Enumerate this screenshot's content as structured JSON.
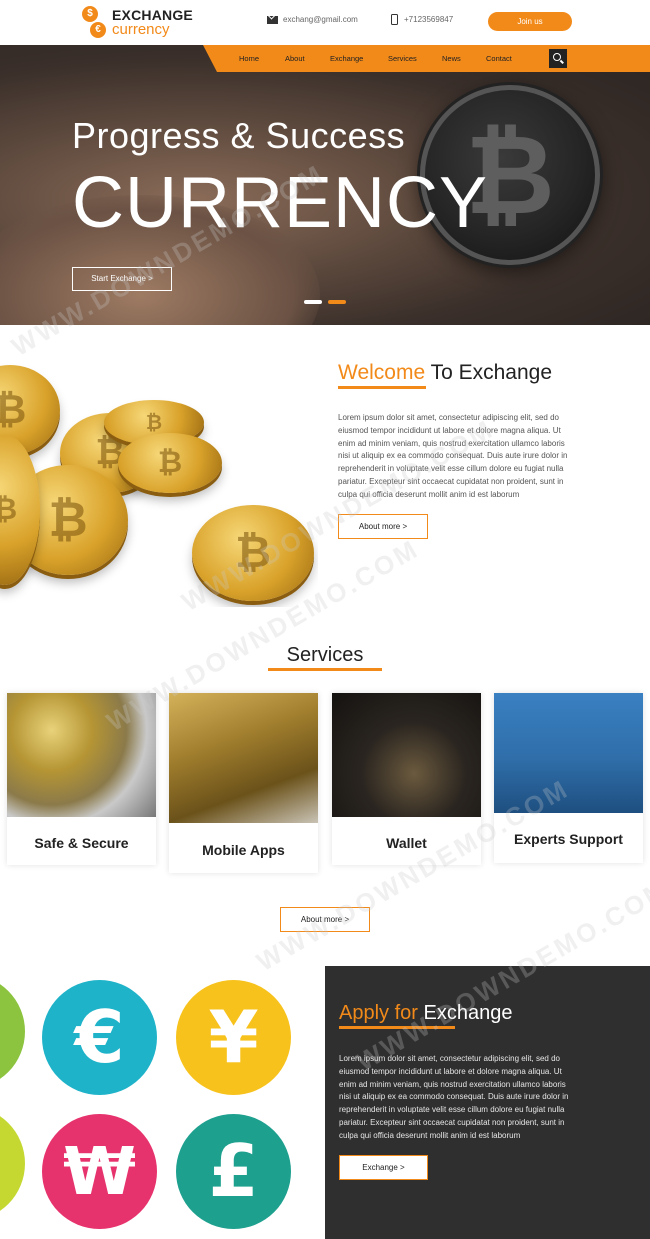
{
  "brand": {
    "name_top": "EXCHANGE",
    "name_bottom": "currency",
    "accent": "#f28a1a"
  },
  "header": {
    "email": "exchang@gmail.com",
    "phone": "+7123569847",
    "join_label": "Join us"
  },
  "nav": {
    "items": [
      "Home",
      "About",
      "Exchange",
      "Services",
      "News",
      "Contact"
    ]
  },
  "hero": {
    "subtitle": "Progress & Success",
    "title": "CURRENCY",
    "button": "Start Exchange >"
  },
  "welcome": {
    "title_highlight": "Welcome",
    "title_rest": " To Exchange",
    "lines": [
      "Lorem ipsum dolor sit amet, consectetur adipiscing elit, sed do",
      "eiusmod tempor incididunt ut labore et dolore magna aliqua. Ut",
      "enim ad minim veniam, quis nostrud exercitation ullamco laboris",
      "nisi ut aliquip ex ea commodo consequat. Duis aute irure dolor in",
      "reprehenderit in voluptate velit esse cillum dolore eu fugiat nulla",
      "pariatur. Excepteur sint occaecat cupidatat non proident, sunt in",
      "culpa qui officia deserunt mollit anim id est laborum"
    ],
    "button": "About more >"
  },
  "services": {
    "title": "Services",
    "cards": [
      {
        "label": "Safe & Secure"
      },
      {
        "label": "Mobile Apps"
      },
      {
        "label": "Wallet"
      },
      {
        "label": "Experts Support"
      }
    ],
    "button": "About more >"
  },
  "apply": {
    "title_highlight": "Apply for",
    "title_rest": " Exchange",
    "lines": [
      "Lorem ipsum dolor sit amet, consectetur adipiscing elit, sed do",
      "eiusmod tempor incididunt ut labore et dolore magna aliqua. Ut",
      "enim ad minim veniam, quis nostrud exercitation ullamco laboris",
      "nisi ut aliquip ex ea commodo consequat. Duis aute irure dolor in",
      "reprehenderit in voluptate velit esse cillum dolore eu fugiat nulla",
      "pariatur. Excepteur sint occaecat cupidatat non proident, sunt in",
      "culpa qui officia deserunt mollit anim id est laborum"
    ],
    "button": "Exchange >"
  },
  "currency_icons": [
    {
      "symbol": "€",
      "color": "#1fb3c9"
    },
    {
      "symbol": "¥",
      "color": "#f7c21c"
    },
    {
      "symbol": "₩",
      "color": "#e7336d"
    },
    {
      "symbol": "£",
      "color": "#1ea08f"
    }
  ],
  "watermark": "WWW.DOWNDEMO.COM"
}
